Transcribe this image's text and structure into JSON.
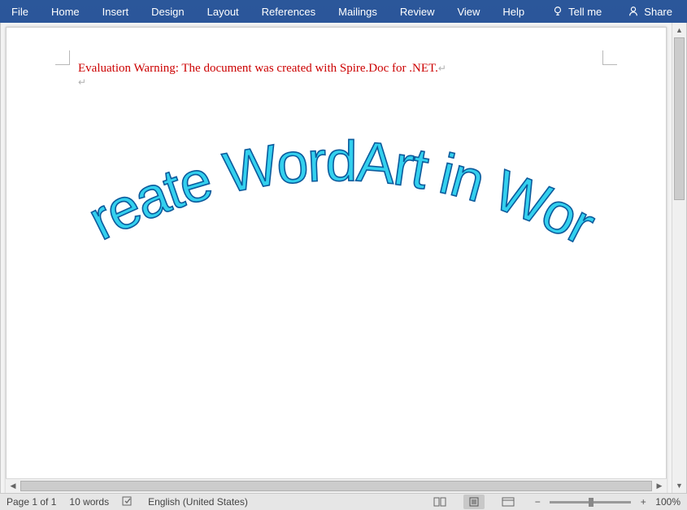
{
  "ribbon": {
    "tabs": [
      "File",
      "Home",
      "Insert",
      "Design",
      "Layout",
      "References",
      "Mailings",
      "Review",
      "View",
      "Help"
    ],
    "tell_me": "Tell me",
    "share": "Share"
  },
  "document": {
    "warning": "Evaluation Warning: The document was created with Spire.Doc for .NET.",
    "wordart_text": "Create WordArt in Word",
    "wordart_fill": "#33d0ee",
    "wordart_stroke": "#0b5a9c"
  },
  "statusbar": {
    "page": "Page 1 of 1",
    "words": "10 words",
    "language": "English (United States)",
    "zoom": "100%"
  }
}
